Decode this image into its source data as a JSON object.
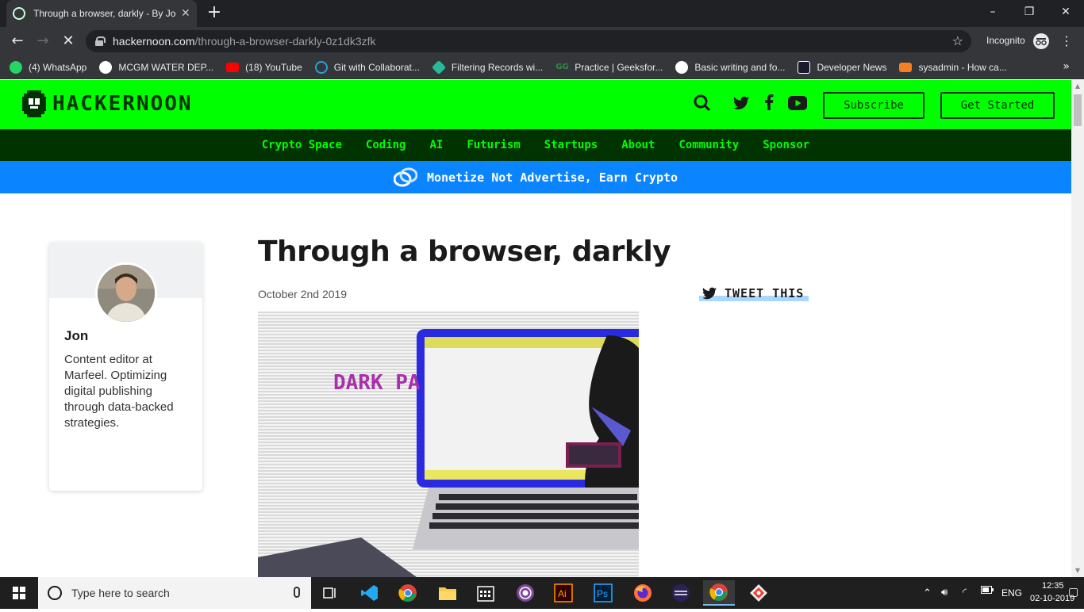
{
  "browser": {
    "tab_title": "Through a browser, darkly - By Jo",
    "url_host": "hackernoon.com",
    "url_path": "/through-a-browser-darkly-0z1dk3zfk",
    "incognito_label": "Incognito",
    "bookmarks": [
      {
        "label": "(4) WhatsApp",
        "color": "#25d366"
      },
      {
        "label": "MCGM WATER DEP...",
        "color": "#ffffff"
      },
      {
        "label": "(18) YouTube",
        "color": "#ff0000"
      },
      {
        "label": "Git with Collaborat...",
        "color": "#2a9fd6"
      },
      {
        "label": "Filtering Records wi...",
        "color": "#26b99a"
      },
      {
        "label": "Practice | Geeksfor...",
        "color": "#2f8d46"
      },
      {
        "label": "Basic writing and fo...",
        "color": "#ffffff"
      },
      {
        "label": "Developer News",
        "color": "#6d5dfc"
      },
      {
        "label": "sysadmin - How ca...",
        "color": "#f48024"
      }
    ]
  },
  "site": {
    "logo_text": "HACKERNOON",
    "subscribe_label": "Subscribe",
    "get_started_label": "Get Started",
    "nav": [
      "Crypto Space",
      "Coding",
      "AI",
      "Futurism",
      "Startups",
      "About",
      "Community",
      "Sponsor"
    ],
    "banner_text": "Monetize Not Advertise, Earn Crypto",
    "brand_green": "#00ff00",
    "nav_bg": "#003300",
    "banner_bg": "#0a84ff"
  },
  "author": {
    "name": "Jon",
    "bio": "Content editor at Marfeel. Optimizing digital publishing through data-backed strategies."
  },
  "article": {
    "title": "Through a browser, darkly",
    "date": "October 2nd 2019",
    "tweet_label": "TWEET THIS",
    "hero_text": "DARK PA"
  },
  "taskbar": {
    "search_placeholder": "Type here to search",
    "language": "ENG",
    "time": "12:35",
    "date": "02-10-2019"
  }
}
